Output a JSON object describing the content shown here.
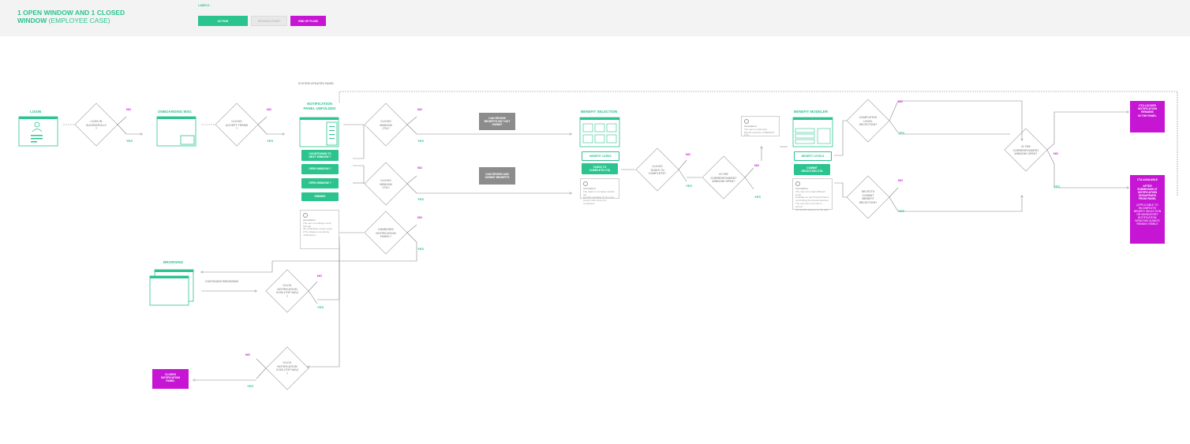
{
  "header": {
    "title_line1": "1 OPEN WINDOW AND 1 CLOSED",
    "title_line2_bold": "WINDOW",
    "title_line2_light": "(EMPLOYEE  CASE)",
    "labels_caption": "LABELS :",
    "legend": [
      {
        "label": "ACTION",
        "color": "#2bc48f"
      },
      {
        "label": "DECISION POINT",
        "color": "#e8e8e8"
      },
      {
        "label": "END  OF FLOW",
        "color": "#c616d4"
      }
    ]
  },
  "screens": {
    "login": "LOGIN",
    "onboarding": "ONBOARDING MSG",
    "notification_line1": "NOTIFICATION",
    "notification_line2": "PANEL UNFOLDED",
    "benefit_selection": "BENEFIT SELECTION",
    "benefit_modeler": "BENEFIT MODELER",
    "browsing": "BROWSING"
  },
  "decisions": {
    "logs_in": [
      "LOGS IN",
      "SUCESSFULLY",
      "?"
    ],
    "accept_terms": [
      "CLICKS",
      "ACCEPT TERMS",
      "?"
    ],
    "cta1": [
      "CLICKS",
      "WINDOW",
      "CTA?"
    ],
    "cta2": [
      "CLICKS",
      "WINDOW",
      "CTA?"
    ],
    "dismiss": [
      "DISMISSES",
      "NOTIFICATION",
      "PANEL?"
    ],
    "tasks_complete": [
      "CLICKS",
      "TASKS TO",
      "COMPLETE?"
    ],
    "window_open1": [
      "IS THE",
      "CORRESPONDENT",
      "WINDOW OPEN?"
    ],
    "completes_level": [
      "COMPLETES",
      "LEVEL",
      "SELECTION?"
    ],
    "commit_selection": [
      "SELECTS",
      "COMMIT",
      "BENEFIT",
      "SELECTION?"
    ],
    "window_open2": [
      "IS THE",
      "CORRESPONDENT",
      "WINDOW OPEN?"
    ],
    "click_notif1": [
      "CLICK",
      "NOTIFICATION",
      "ICON (TOP NAV)",
      "?"
    ],
    "click_notif2": [
      "CLICK",
      "NOTIFICATION",
      "ICON (TOP NAV)",
      "?"
    ]
  },
  "answers": {
    "no": "NO",
    "yes": "YES"
  },
  "actions": {
    "countdown": [
      "COUNTDOWN TO",
      "NEXT WINDOW ?"
    ],
    "open_window_1": "OPEN WINDOW ?",
    "open_window_2": "OPEN WINDOW ?",
    "dismiss": "DISMISS",
    "benefit_cards": "BENEFIT CARDS",
    "tasks_to_complete": [
      "TASKS TO",
      "COMPLETE CTA"
    ],
    "benefit_levels": "BENEFIT LEVELS",
    "commit_selection": [
      "COMMIT",
      "SELECTION CTA"
    ]
  },
  "grey_boxes": {
    "can_review": [
      "CAN REVIEW",
      "BENEFITS BUT NOT",
      "SUBMIT"
    ],
    "can_review_submit": [
      "CAN REVIEW AND",
      "SUBMIT BENEFITS"
    ]
  },
  "ends": {
    "cta_locked": [
      "CTA LOCKED",
      "NOTIFICATION",
      "REMAINS",
      "IN THE PANEL"
    ],
    "cta_available": [
      "CTA AVAILABLE",
      "",
      "AFTER",
      "SUBMISSION,IT",
      "NOTIFICATION",
      "DISSAPEARS",
      "FROM PANEL",
      "",
      "(APPLICABLE TO",
      "INCOMPLETE",
      "BENEFIT SELECTION",
      "OR MANDATORY",
      "NOTIFICATION.",
      "WINDOWS ALWAYS",
      "REMAIN VISIBLE"
    ],
    "closes_panel": [
      "CLOSES",
      "NOTIFICATION",
      "PANEL"
    ]
  },
  "notes": {
    "notification": [
      "Annotation",
      "The user can always scroll through",
      "the notification center panel.",
      "CTA collapses remaining",
      "notifications."
    ],
    "benefit": [
      "Annotation",
      "The tasks to complete include the",
      "benefits available for the user.",
      "Check mark shown for completed."
    ],
    "window": [
      "Annotation",
      "The user is redirected",
      "Benefit selection of BENEFIT CTA"
    ],
    "modeler": [
      "Annotation",
      "The user can model different levels",
      "available for each benefit before",
      "committing the benefit selection.",
      "The user then commits to submit",
      "the benefit selection at the right."
    ]
  },
  "flow_labels": {
    "system_updates": "SYSTEM UPDATES PANEL",
    "continues_browsing": "CONTINUES BROWSING"
  }
}
